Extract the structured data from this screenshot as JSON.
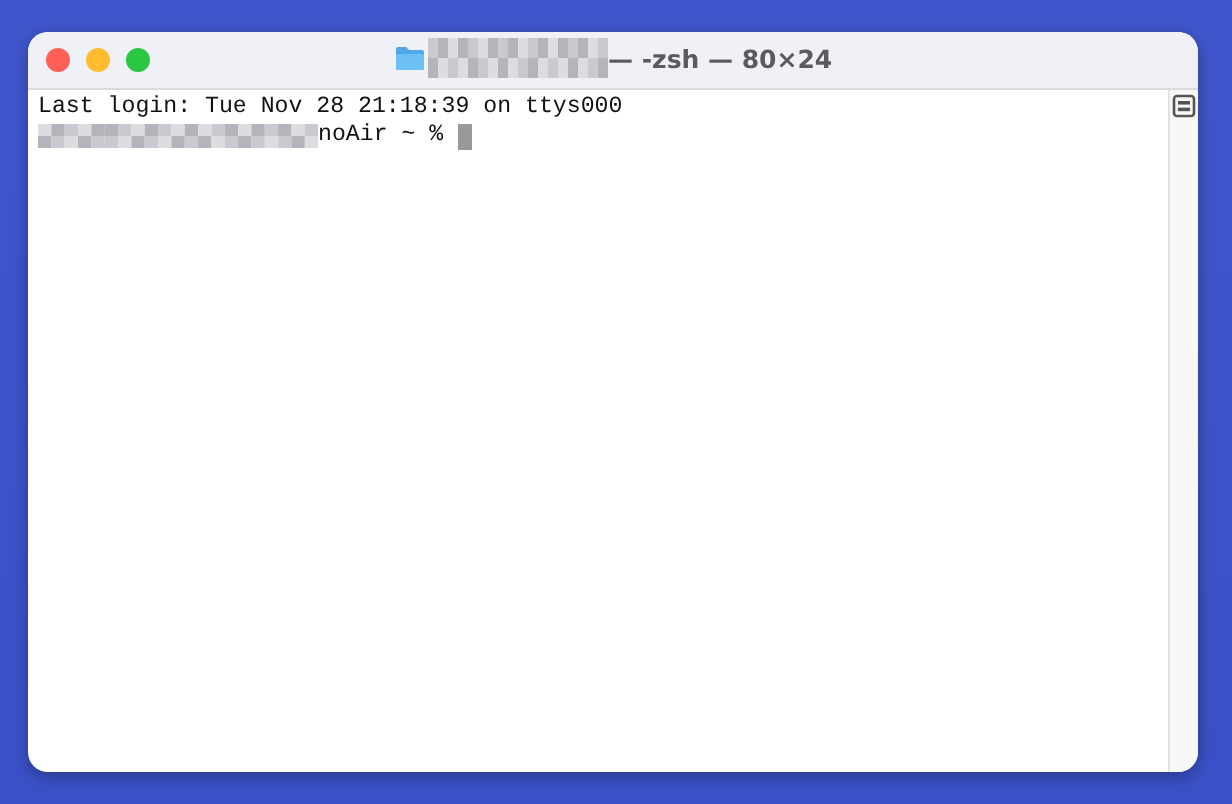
{
  "window": {
    "title": "— -zsh — 80×24"
  },
  "terminal": {
    "lines": [
      "Last login: Tue Nov 28 21:18:39 on ttys000"
    ],
    "prompt": "noAir ~ %"
  }
}
